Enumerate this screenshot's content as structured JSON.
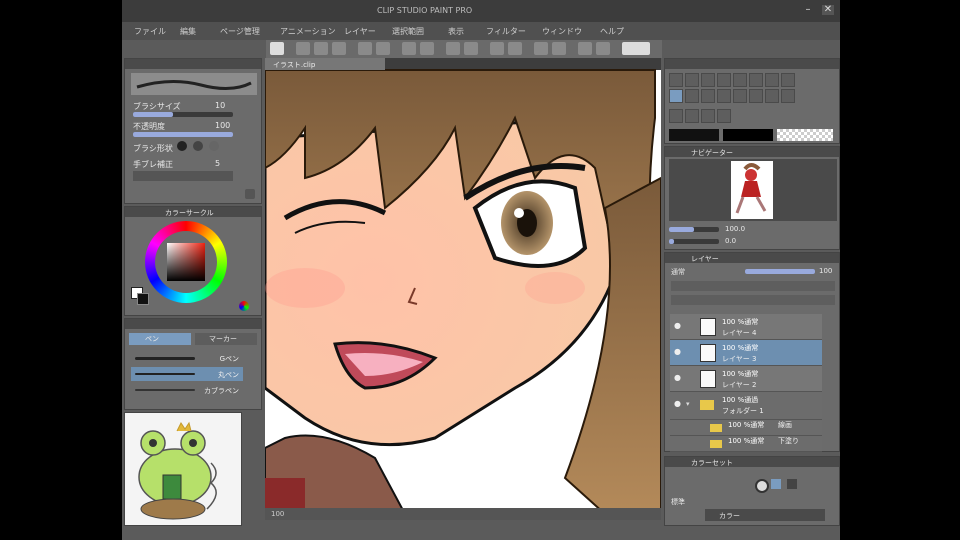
{
  "window": {
    "title": "CLIP STUDIO PAINT PRO"
  },
  "menu": {
    "items": [
      "ファイル",
      "編集",
      "ページ管理",
      "アニメーション",
      "レイヤー",
      "選択範囲",
      "表示",
      "フィルター",
      "ウィンドウ",
      "ヘルプ"
    ]
  },
  "tool_property": {
    "brush_size_label": "ブラシサイズ",
    "brush_size_value": "10",
    "opacity_label": "不透明度",
    "opacity_value": "100",
    "shape_label": "ブラシ形状",
    "stabilization_label": "手ブレ補正",
    "stabilization_value": "5"
  },
  "color_panel": {
    "title": "カラーサークル"
  },
  "sub_tool": {
    "tabs": [
      "ペン",
      "マーカー"
    ],
    "items": [
      "Gペン",
      "丸ペン",
      "カブラペン"
    ],
    "selected_index": 1
  },
  "canvas": {
    "tab_label": "イラスト.clip",
    "zoom": "100"
  },
  "navigator": {
    "title": "ナビゲーター",
    "zoom": "100.0",
    "rotation": "0.0"
  },
  "layers": {
    "title": "レイヤー",
    "mode": "通常",
    "opacity": "100",
    "rows": [
      {
        "name": "100 %通常",
        "sub": "レイヤー 4",
        "selected": false
      },
      {
        "name": "100 %通常",
        "sub": "レイヤー 3",
        "selected": true
      },
      {
        "name": "100 %通常",
        "sub": "レイヤー 2",
        "selected": false
      }
    ],
    "folders": [
      {
        "name": "100 %通過",
        "sub": "フォルダー 1"
      },
      {
        "name": "100 %通常",
        "sub": "線画"
      },
      {
        "name": "100 %通常",
        "sub": "下塗り"
      }
    ]
  },
  "color_set": {
    "title": "カラーセット",
    "label": "標準",
    "dropdown": "カラー"
  },
  "colors": {
    "accent": "#6d8fb0",
    "bg": "#5b5b5b",
    "panel": "#6b6b6b"
  }
}
